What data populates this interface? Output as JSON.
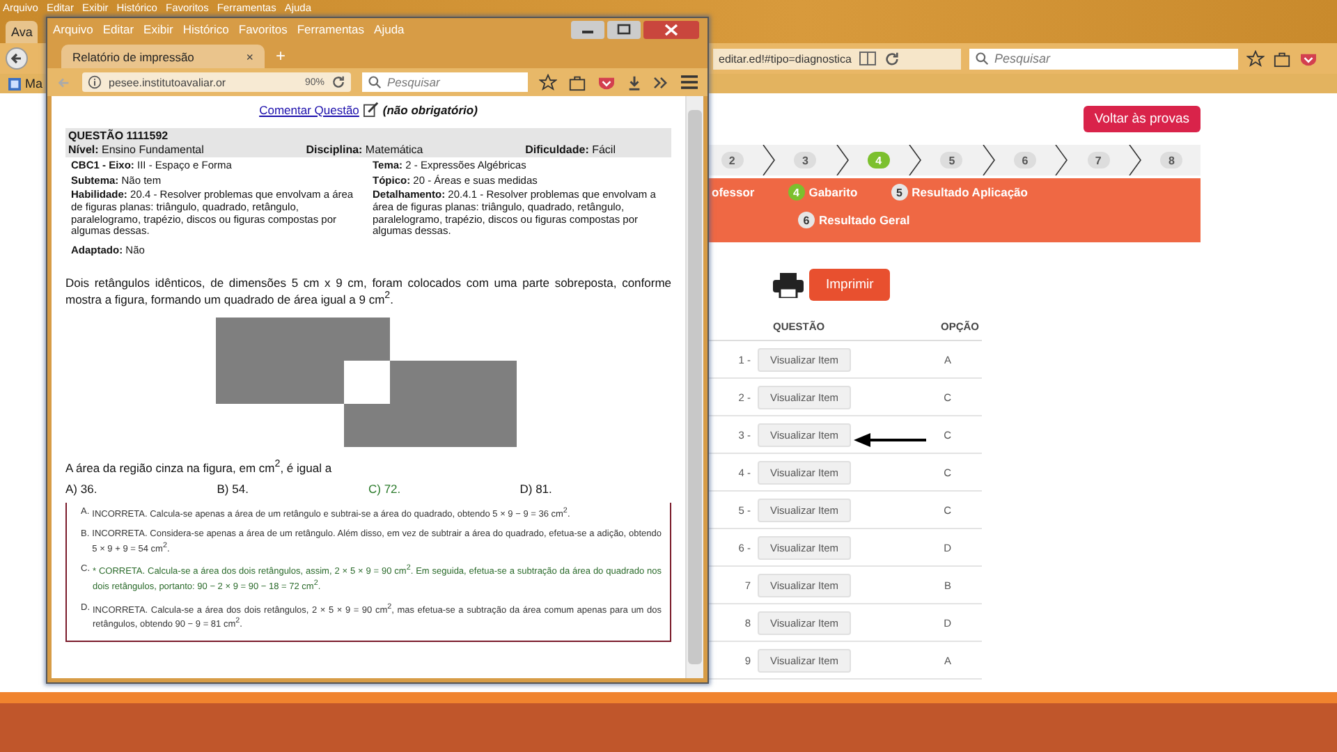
{
  "background_browser": {
    "menu": [
      "Arquivo",
      "Editar",
      "Exibir",
      "Histórico",
      "Favoritos",
      "Ferramentas",
      "Ajuda"
    ],
    "tab": "Ava",
    "address": "editar.ed!#tipo=diagnostica",
    "search_placeholder": "Pesquisar",
    "bookmark": "Ma"
  },
  "page": {
    "back_button": "Voltar às provas",
    "steps": [
      {
        "number": "2",
        "selected": false
      },
      {
        "number": "3",
        "selected": false
      },
      {
        "number": "4",
        "selected": true
      },
      {
        "number": "5",
        "selected": false
      },
      {
        "number": "6",
        "selected": false
      },
      {
        "number": "7",
        "selected": false
      },
      {
        "number": "8",
        "selected": false
      }
    ],
    "wizard": [
      {
        "label": "ofessor"
      },
      {
        "number": "4",
        "label": "Gabarito",
        "selected": true
      },
      {
        "number": "5",
        "label": "Resultado Aplicação",
        "selected": false
      },
      {
        "number": "6",
        "label": "Resultado Geral",
        "selected": false
      }
    ],
    "print_button": "Imprimir",
    "table": {
      "columns": [
        "QUESTÃO",
        "OPÇÃO"
      ],
      "rows": [
        {
          "number": "1 -",
          "action": "Visualizar Item",
          "option": "A"
        },
        {
          "number": "2 -",
          "action": "Visualizar Item",
          "option": "C"
        },
        {
          "number": "3 -",
          "action": "Visualizar Item",
          "option": "C"
        },
        {
          "number": "4 -",
          "action": "Visualizar Item",
          "option": "C"
        },
        {
          "number": "5 -",
          "action": "Visualizar Item",
          "option": "C"
        },
        {
          "number": "6 -",
          "action": "Visualizar Item",
          "option": "D"
        },
        {
          "number": "7",
          "action": "Visualizar Item",
          "option": "B"
        },
        {
          "number": "8",
          "action": "Visualizar Item",
          "option": "D"
        },
        {
          "number": "9",
          "action": "Visualizar Item",
          "option": "A"
        }
      ]
    }
  },
  "popup": {
    "menu": [
      "Arquivo",
      "Editar",
      "Exibir",
      "Histórico",
      "Favoritos",
      "Ferramentas",
      "Ajuda"
    ],
    "tab": "Relatório de impressão",
    "tab_close": "×",
    "new_tab": "+",
    "address": "pesee.institutoavaliar.or",
    "zoom": "90%",
    "search_placeholder": "Pesquisar",
    "comment_link": "Comentar Questão",
    "comment_note": "(não obrigatório)",
    "question_id": "QUESTÃO 1111592",
    "summary": [
      "**Nível:** Ensino Fundamental",
      "**Disciplina:** Matemática",
      "**Dificuldade:** Fácil"
    ],
    "details": [
      [
        "**CBC1 - Eixo:** III - Espaço e Forma",
        "**Tema:** 2 - Expressões Algébricas"
      ],
      [
        "**Subtema:** Não tem",
        "**Tópico:** 20 - Áreas e suas medidas"
      ],
      [
        "**Habilidade:** 20.4 - Resolver problemas que envolvam a área de figuras planas: triângulo, quadrado, retângulo, paralelogramo, trapézio, discos ou figuras compostas por algumas dessas.",
        "**Detalhamento:** 20.4.1 - Resolver problemas que envolvam a área de figuras planas: triângulo, quadrado, retângulo, paralelogramo, trapézio, discos ou figuras compostas por algumas dessas."
      ]
    ],
    "adapted": "**Adaptado:** Não",
    "statement": "Dois retângulos idênticos, de dimensões 5 cm x 9 cm, foram colocados com uma parte sobreposta, conforme mostra a figura, formando um quadrado de área igual a 9 cm$^{2}$.",
    "prompt": "A área da região cinza na figura, em cm$^{2}$, é igual a",
    "options": [
      {
        "letter": "A)",
        "text": "36.",
        "correct": false
      },
      {
        "letter": "B)",
        "text": "54.",
        "correct": false
      },
      {
        "letter": "C)",
        "text": "72.",
        "correct": true
      },
      {
        "letter": "D)",
        "text": "81.",
        "correct": false
      }
    ],
    "explanations": [
      {
        "letter": "A.",
        "text": "INCORRETA. Calcula-se apenas a área de um retângulo e subtrai-se a área do quadrado, obtendo 5 × 9 − 9 = 36 cm$^{2}$.",
        "correct": false
      },
      {
        "letter": "B.",
        "text": "INCORRETA. Considera-se apenas a área de um retângulo. Além disso, em vez de subtrair a área do quadrado, efetua-se a adição, obtendo 5 × 9 + 9 = 54 cm$^{2}$.",
        "correct": false
      },
      {
        "letter": "C.",
        "text": "* CORRETA. Calcula-se a área dos dois retângulos, assim, 2 × 5 × 9 = 90 cm$^{2}$. Em seguida, efetua-se a subtração da área do quadrado nos dois retângulos, portanto: 90 − 2 × 9 = 90 − 18 = 72 cm$^{2}$.",
        "correct": true
      },
      {
        "letter": "D.",
        "text": "INCORRETA. Calcula-se a área dos dois retângulos, 2 × 5 × 9 = 90 cm$^{2}$, mas efetua-se a subtração da área comum apenas para um dos retângulos, obtendo 90 − 9 = 81 cm$^{2}$.",
        "correct": false
      }
    ]
  }
}
